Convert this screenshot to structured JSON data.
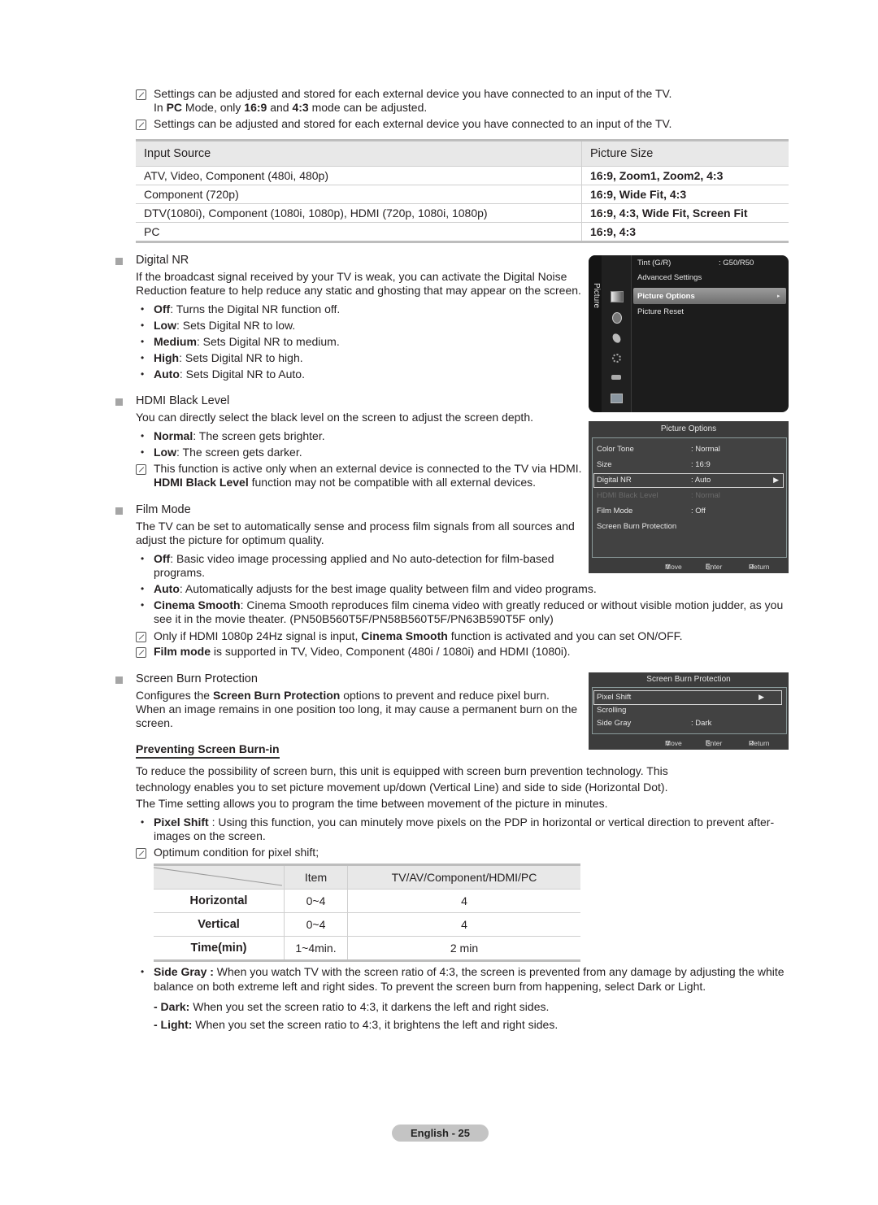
{
  "intro_notes": [
    {
      "parts": [
        "Settings can be adjusted and stored for each external device you have connected to an input of the TV."
      ]
    },
    {
      "parts": [
        "In ",
        "PC",
        " Mode, only ",
        "16:9",
        " and ",
        "4:3",
        " mode can be adjusted."
      ]
    },
    {
      "parts": [
        "Settings can be adjusted and stored for each external device you have connected to an input of the TV."
      ]
    }
  ],
  "size_table": {
    "headers": [
      "Input Source",
      "Picture Size"
    ],
    "rows": [
      [
        "ATV, Video, Component (480i, 480p)",
        "16:9, Zoom1, Zoom2, 4:3"
      ],
      [
        "Component (720p)",
        "16:9, Wide Fit, 4:3"
      ],
      [
        "DTV(1080i), Component (1080i, 1080p), HDMI (720p, 1080i, 1080p)",
        "16:9, 4:3, Wide Fit, Screen Fit"
      ],
      [
        "PC",
        "16:9, 4:3"
      ]
    ]
  },
  "digital_nr": {
    "title": "Digital NR",
    "desc_lines": [
      "If the broadcast signal received by your TV is weak, you can activate the Digital Noise",
      "Reduction feature to help reduce any static and ghosting that may appear on the screen."
    ],
    "bullets": [
      {
        "term": "Off",
        "text": ": Turns the Digital NR function off."
      },
      {
        "term": "Low",
        "text": ": Sets Digital NR to low."
      },
      {
        "term": "Medium",
        "text": ": Sets Digital NR to medium."
      },
      {
        "term": "High",
        "text": ": Sets Digital NR to high."
      },
      {
        "term": "Auto",
        "text": ": Sets Digital NR to Auto."
      }
    ]
  },
  "hdmi_black": {
    "title": "HDMI Black Level",
    "desc": "You can directly select the black level on the screen to adjust the screen depth.",
    "bullets": [
      {
        "term": "Normal",
        "text": ": The screen gets brighter."
      },
      {
        "term": "Low",
        "text": ": The screen gets darker."
      }
    ],
    "note_line1": "This function is active only when an external device is connected to the TV via HDMI.",
    "note_line2_bold": "HDMI Black Level",
    "note_line2_rest": " function may not be compatible with all external devices."
  },
  "film_mode": {
    "title": "Film Mode",
    "desc_lines": [
      "The TV can be set to automatically sense and process film signals from all sources and",
      "adjust the picture for optimum quality."
    ],
    "off_term": "Off",
    "off_line1": ": Basic video image processing applied and No auto-detection for film-based",
    "off_line2": "programs.",
    "auto_term": "Auto",
    "auto_text": ": Automatically adjusts for the best image quality between film and video programs.",
    "cinema_term": "Cinema Smooth",
    "cinema_line1": ": Cinema Smooth reproduces film cinema video with greatly reduced or without visible motion judder, as you",
    "cinema_line2": "see it in the movie theater. (PN50B560T5F/PN58B560T5F/PN63B590T5F   only)",
    "note1_pre": "Only if HDMI 1080p 24Hz signal is input, ",
    "note1_bold": "Cinema Smooth",
    "note1_post": " function is activated and you can set ON/OFF.",
    "note2_bold": "Film mode",
    "note2_post": " is supported in TV, Video, Component (480i / 1080i)  and HDMI (1080i)."
  },
  "screen_burn": {
    "title": "Screen Burn Protection",
    "desc1_pre": "Configures the ",
    "desc1_bold": "Screen Burn Protection",
    "desc1_post": " options to prevent and reduce pixel burn.",
    "desc2": "When an image remains in one position too long, it may cause a permanent burn on the",
    "desc3": "screen.",
    "subheading": "Preventing Screen Burn-in",
    "para_lines": [
      "To reduce the possibility of screen burn, this unit is equipped with screen burn prevention technology. This",
      "technology enables you to set picture movement up/down (Vertical Line) and side to side (Horizontal Dot).",
      "The Time setting allows you to program the time between movement of the picture in minutes."
    ],
    "pixel_term": "Pixel Shift",
    "pixel_line1": " : Using this function, you can minutely move pixels on the PDP in horizontal or vertical direction to prevent after-",
    "pixel_line2": "images on the screen.",
    "note": "Optimum condition for pixel shift;",
    "shift_table": {
      "headers": [
        "",
        "Item",
        "TV/AV/Component/HDMI/PC"
      ],
      "rows": [
        [
          "Horizontal",
          "0~4",
          "4"
        ],
        [
          "Vertical",
          "0~4",
          "4"
        ],
        [
          "Time(min)",
          "1~4min.",
          "2 min"
        ]
      ]
    },
    "side_term": "Side Gray :",
    "side_line1": " When you watch TV with the screen ratio of 4:3, the screen is prevented from any damage by adjusting the white",
    "side_line2": "balance on both extreme left and right sides. To prevent the screen burn from happening, select Dark or Light.",
    "dark_term": "- Dark:",
    "dark_text": " When you set the screen ratio to 4:3, it darkens the left and right sides.",
    "light_term": "- Light:",
    "light_text": " When you set the screen ratio to 4:3, it brightens the left and right sides."
  },
  "tv_menu_picture": {
    "rail_label": "Picture",
    "items": [
      {
        "label": "Tint (G/R)",
        "value": ": G50/R50"
      },
      {
        "label": "Advanced Settings",
        "value": ""
      },
      {
        "label": "Picture Options",
        "value": "",
        "selected": true
      },
      {
        "label": "Picture Reset",
        "value": ""
      }
    ],
    "icons": [
      "picture-icon",
      "sound-icon",
      "channel-icon",
      "setup-icon",
      "input-icon",
      "application-icon"
    ]
  },
  "tv_menu_options": {
    "title": "Picture Options",
    "items": [
      {
        "label": "Color Tone",
        "value": ": Normal"
      },
      {
        "label": "Size",
        "value": ": 16:9"
      },
      {
        "label": "Digital NR",
        "value": ": Auto",
        "selected": true
      },
      {
        "label": "HDMI Black Level",
        "value": ": Normal",
        "disabled": true
      },
      {
        "label": "Film Mode",
        "value": ": Off"
      },
      {
        "label": "Screen Burn Protection",
        "value": ""
      }
    ],
    "footer": {
      "move": "Move",
      "enter": "Enter",
      "return": "Return"
    }
  },
  "tv_menu_burn": {
    "title": "Screen Burn Protection",
    "items": [
      {
        "label": "Pixel Shift",
        "value": "",
        "selected": true
      },
      {
        "label": "Scrolling",
        "value": ""
      },
      {
        "label": "Side Gray",
        "value": ": Dark"
      }
    ],
    "footer": {
      "move": "Move",
      "enter": "Enter",
      "return": "Return"
    }
  },
  "page_number": "English - 25"
}
